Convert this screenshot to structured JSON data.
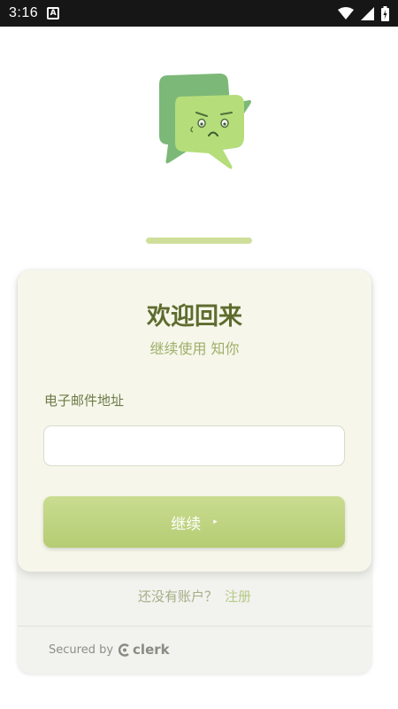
{
  "status_bar": {
    "time": "3:16",
    "app_icon": "A",
    "icons": [
      "wifi-icon",
      "signal-icon",
      "battery-icon"
    ]
  },
  "progress": {
    "value": 1.0
  },
  "card": {
    "title": "欢迎回来",
    "subtitle": "继续使用 知你",
    "email_label": "电子邮件地址",
    "email_value": "",
    "email_placeholder": "",
    "continue_label": "继续",
    "continue_icon": "▸"
  },
  "footer": {
    "no_account_text": "还没有账户？",
    "signup_link": "注册",
    "secured_by": "Secured by",
    "brand": "clerk"
  },
  "colors": {
    "accent": "#b6cc73",
    "title": "#5e6b2e",
    "logo_back": "#7cb878",
    "logo_front": "#b5dd7a"
  }
}
